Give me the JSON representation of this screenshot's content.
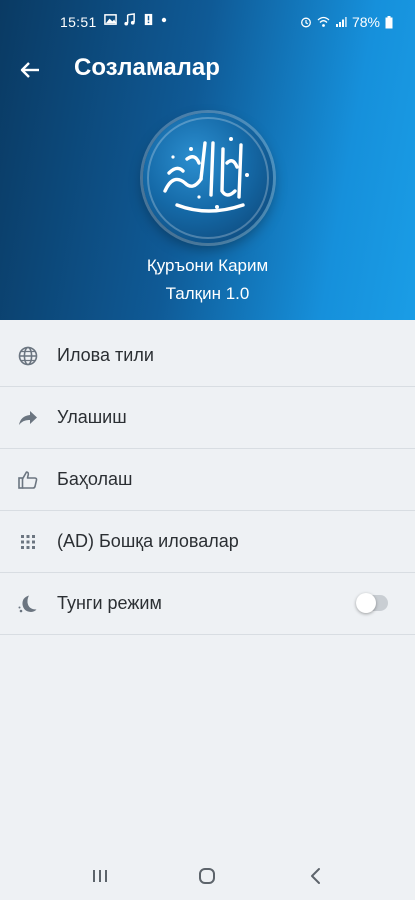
{
  "status_bar": {
    "time": "15:51",
    "battery": "78%",
    "icons": [
      "image-icon",
      "music-icon",
      "sim-alert-icon",
      "dot-icon",
      "alarm-icon",
      "wifi-icon",
      "signal-icon",
      "battery-icon"
    ]
  },
  "app_bar": {
    "title": "Созламалар",
    "back_icon": "arrow-left-icon"
  },
  "app_info": {
    "name": "Қуръони Карим",
    "version": "Талқин 1.0",
    "logo": "quran-calligraphy-logo"
  },
  "menu": {
    "items": [
      {
        "label": "Илова тили",
        "icon": "globe-icon"
      },
      {
        "label": "Улашиш",
        "icon": "share-arrow-icon"
      },
      {
        "label": "Баҳолаш",
        "icon": "thumbs-up-icon"
      },
      {
        "label": "(AD) Бошқа иловалар",
        "icon": "apps-grid-icon"
      },
      {
        "label": "Тунги режим",
        "icon": "moon-icon",
        "toggle": false
      }
    ]
  },
  "nav_bar": {
    "buttons": [
      "recent-apps-icon",
      "home-icon",
      "back-icon"
    ]
  },
  "colors": {
    "header_dark": "#0a3a63",
    "header_light": "#1a9de6",
    "background": "#eef1f4",
    "text": "#2b2f33",
    "icon": "#6b7580"
  }
}
